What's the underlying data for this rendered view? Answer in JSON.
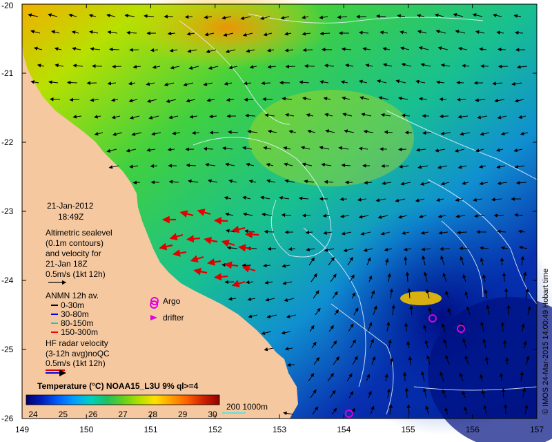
{
  "map": {
    "lon_ticks": [
      "149",
      "150",
      "151",
      "152",
      "153",
      "154",
      "155",
      "156",
      "157"
    ],
    "lat_ticks": [
      "-20",
      "-21",
      "-22",
      "-23",
      "-24",
      "-25",
      "-26"
    ],
    "ocean_gradient": [
      "#ffd000",
      "#9be000",
      "#2fd02f",
      "#18b8a8",
      "#1070e0",
      "#0018a0"
    ],
    "land_color": "#f5c8a0",
    "contour_color": "#e8f4ff"
  },
  "annotations": {
    "date": "21-Jan-2012",
    "time": "18:49Z",
    "altimetry": [
      "Altimetric sealevel",
      "(0.1m contours)",
      "and velocity for",
      "21-Jan 18Z",
      "0.5m/s (1kt 12h)"
    ],
    "anmn_title": "ANMN 12h av.",
    "anmn_depths": [
      {
        "label": "0-30m",
        "color": "#000000"
      },
      {
        "label": "30-80m",
        "color": "#0000ff"
      },
      {
        "label": "80-150m",
        "color": "#00d0d0"
      },
      {
        "label": "150-300m",
        "color": "#ff0000"
      }
    ],
    "argo_label": "Argo",
    "drifter_label": "drifter",
    "hf_radar": [
      "HF radar velocity",
      "(3-12h avg)noQC",
      "0.5m/s (1kt 12h)"
    ],
    "credit": "© IMOS 24-Mar-2015 14:00:49 Hobart time"
  },
  "colorbar": {
    "title": "Temperature (°C) NOAA15_L3U 9% ql>=4",
    "labels": [
      "24",
      "25",
      "26",
      "27",
      "28",
      "29",
      "30"
    ],
    "colors": [
      "#000070",
      "#0020c0",
      "#0060ff",
      "#00a0ff",
      "#00d0c0",
      "#20c060",
      "#60d020",
      "#b0e000",
      "#ffe000",
      "#ffa000",
      "#ff6000",
      "#d02000",
      "#900000"
    ],
    "contour_legend": "200  1000m"
  },
  "argo_floats": [
    {
      "lon": 151.05,
      "lat": -24.35
    },
    {
      "lon": 155.38,
      "lat": -24.55
    },
    {
      "lon": 155.82,
      "lat": -24.7
    },
    {
      "lon": 154.08,
      "lat": -25.93
    }
  ]
}
